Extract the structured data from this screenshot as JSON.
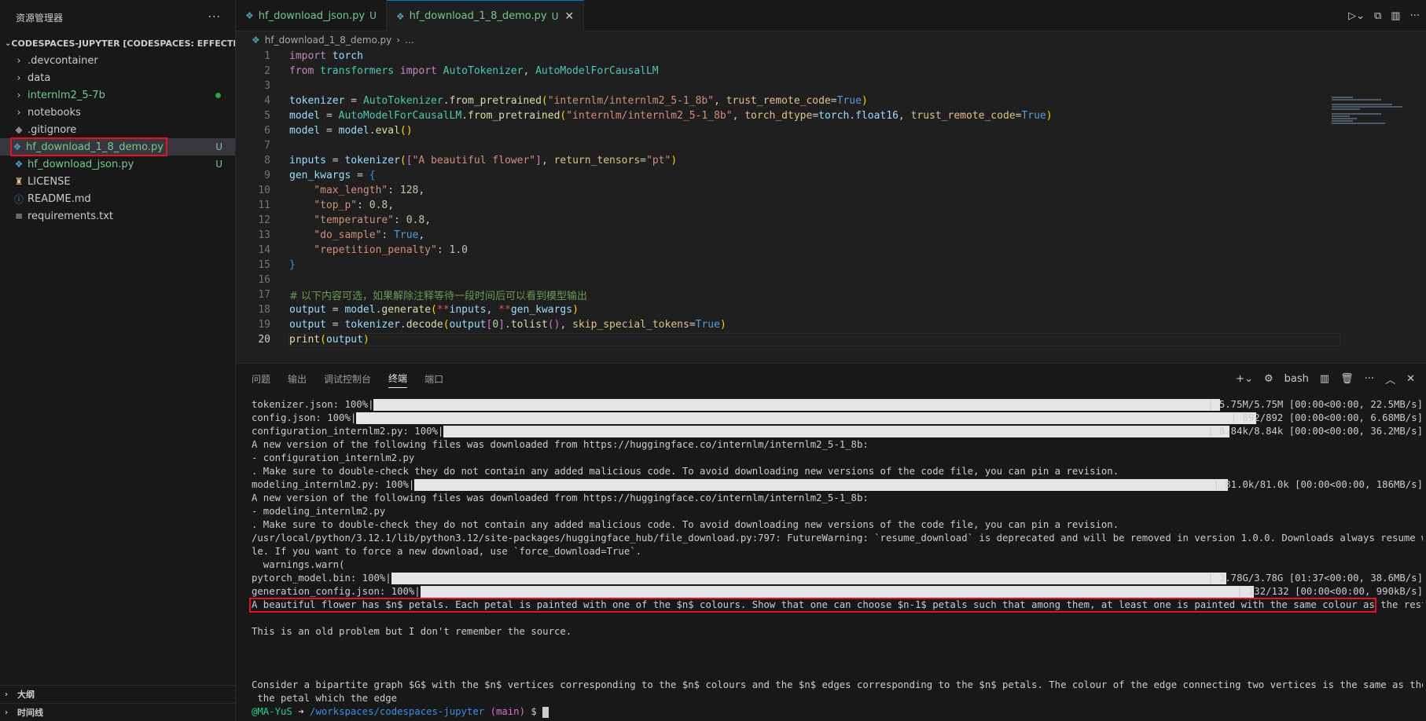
{
  "sidebar": {
    "title": "资源管理器",
    "more": "···",
    "workspace": "CODESPACES-JUPYTER [CODESPACES: EFFECTIVE P...",
    "items": [
      {
        "label": ".devcontainer",
        "type": "folder",
        "status": ""
      },
      {
        "label": "data",
        "type": "folder",
        "status": ""
      },
      {
        "label": "internlm2_5-7b",
        "type": "folder",
        "status": "dot"
      },
      {
        "label": "notebooks",
        "type": "folder",
        "status": ""
      },
      {
        "label": ".gitignore",
        "type": "git",
        "status": ""
      },
      {
        "label": "hf_download_1_8_demo.py",
        "type": "py",
        "status": "U"
      },
      {
        "label": "hf_download_json.py",
        "type": "py",
        "status": "U"
      },
      {
        "label": "LICENSE",
        "type": "license",
        "status": ""
      },
      {
        "label": "README.md",
        "type": "info",
        "status": ""
      },
      {
        "label": "requirements.txt",
        "type": "txt",
        "status": ""
      }
    ],
    "outline": "大纲",
    "timeline": "时间线"
  },
  "tabs": [
    {
      "label": "hf_download_json.py",
      "status": "U"
    },
    {
      "label": "hf_download_1_8_demo.py",
      "status": "U"
    }
  ],
  "breadcrumb": {
    "file": "hf_download_1_8_demo.py",
    "more": "..."
  },
  "code": {
    "line_numbers": [
      "1",
      "2",
      "3",
      "4",
      "5",
      "6",
      "7",
      "8",
      "9",
      "10",
      "11",
      "12",
      "13",
      "14",
      "15",
      "16",
      "17",
      "18",
      "19",
      "20"
    ],
    "current_line": "20",
    "lines": {
      "l1a": "import",
      "l1b": " torch",
      "l2a": "from",
      "l2b": " transformers ",
      "l2c": "import",
      "l2d": " AutoTokenizer",
      "l2e": ", ",
      "l2f": "AutoModelForCausalLM",
      "l4a": "tokenizer",
      "l4b": " = ",
      "l4c": "AutoTokenizer",
      "l4d": ".",
      "l4e": "from_pretrained",
      "l4f": "(",
      "l4g": "\"internlm/internlm2_5-1_8b\"",
      "l4h": ", ",
      "l4i": "trust_remote_code",
      "l4j": "=",
      "l4k": "True",
      "l4l": ")",
      "l5a": "model",
      "l5b": " = ",
      "l5c": "AutoModelForCausalLM",
      "l5d": ".",
      "l5e": "from_pretrained",
      "l5f": "(",
      "l5g": "\"internlm/internlm2_5-1_8b\"",
      "l5h": ", ",
      "l5i": "torch_dtype",
      "l5j": "=",
      "l5k": "torch",
      "l5l": ".float16, ",
      "l5m": "trust_remote_code",
      "l5n": "=",
      "l5o": "True",
      "l5p": ")",
      "l6a": "model",
      "l6b": " = ",
      "l6c": "model",
      "l6d": ".",
      "l6e": "eval",
      "l6f": "()",
      "l8a": "inputs",
      "l8b": " = ",
      "l8c": "tokenizer",
      "l8d": "(",
      "l8e": "[",
      "l8f": "\"A beautiful flower\"",
      "l8g": "]",
      "l8h": ", ",
      "l8i": "return_tensors",
      "l8j": "=",
      "l8k": "\"pt\"",
      "l8l": ")",
      "l9a": "gen_kwargs",
      "l9b": " = ",
      "l9c": "{",
      "l10a": "    \"max_length\"",
      "l10b": ": ",
      "l10c": "128",
      "l10d": ",",
      "l11a": "    \"top_p\"",
      "l11b": ": ",
      "l11c": "0.8",
      "l11d": ",",
      "l12a": "    \"temperature\"",
      "l12b": ": ",
      "l12c": "0.8",
      "l12d": ",",
      "l13a": "    \"do_sample\"",
      "l13b": ": ",
      "l13c": "True",
      "l13d": ",",
      "l14a": "    \"repetition_penalty\"",
      "l14b": ": ",
      "l14c": "1.0",
      "l15a": "}",
      "l17a": "# 以下内容可选，如果解除注释等待一段时间后可以看到模型输出",
      "l18a": "output",
      "l18b": " = ",
      "l18c": "model",
      "l18d": ".",
      "l18e": "generate",
      "l18f": "(",
      "l18g": "**",
      "l18h": "inputs",
      "l18i": ", ",
      "l18j": "**",
      "l18k": "gen_kwargs",
      "l18l": ")",
      "l19a": "output",
      "l19b": " = ",
      "l19c": "tokenizer",
      "l19d": ".",
      "l19e": "decode",
      "l19f": "(",
      "l19g": "output",
      "l19h": "[",
      "l19i": "0",
      "l19j": "]",
      "l19k": ".",
      "l19l": "tolist",
      "l19m": "()",
      "l19n": ", ",
      "l19o": "skip_special_tokens",
      "l19p": "=",
      "l19q": "True",
      "l19r": ")",
      "l20a": "print",
      "l20b": "(",
      "l20c": "output",
      "l20d": ")"
    }
  },
  "panel": {
    "tabs": [
      "问题",
      "输出",
      "调试控制台",
      "终端",
      "端口"
    ],
    "active_tab": "终端",
    "shell": "bash"
  },
  "terminal": {
    "progress": [
      {
        "label": "tokenizer.json: 100%|",
        "stats": "| 5.75M/5.75M [00:00<00:00, 22.5MB/s]",
        "fraction": 1.0
      },
      {
        "label": "config.json: 100%|",
        "stats": "| 892/892 [00:00<00:00, 6.68MB/s]",
        "fraction": 1.0
      },
      {
        "label": "configuration_internlm2.py: 100%|",
        "stats": "| 8.84k/8.84k [00:00<00:00, 36.2MB/s]",
        "fraction": 1.0
      },
      {
        "label": "modeling_internlm2.py: 100%|",
        "stats": "| 81.0k/81.0k [00:00<00:00, 186MB/s]",
        "fraction": 1.0
      },
      {
        "label": "pytorch_model.bin: 100%|",
        "stats": "| 3.78G/3.78G [01:37<00:00, 38.6MB/s]",
        "fraction": 1.0
      },
      {
        "label": "generation_config.json: 100%|",
        "stats": "| 132/132 [00:00<00:00, 990kB/s]",
        "fraction": 1.0
      }
    ],
    "msg1": "A new version of the following files was downloaded from https://huggingface.co/internlm/internlm2_5-1_8b:",
    "msg1_file": "- configuration_internlm2.py",
    "msg1_note": ". Make sure to double-check they do not contain any added malicious code. To avoid downloading new versions of the code file, you can pin a revision.",
    "msg2": "A new version of the following files was downloaded from https://huggingface.co/internlm/internlm2_5-1_8b:",
    "msg2_file": "- modeling_internlm2.py",
    "msg2_note": ". Make sure to double-check they do not contain any added malicious code. To avoid downloading new versions of the code file, you can pin a revision.",
    "warn1": "/usr/local/python/3.12.1/lib/python3.12/site-packages/huggingface_hub/file_download.py:797: FutureWarning: `resume_download` is deprecated and will be removed in version 1.0.0. Downloads always resume when possib",
    "warn2": "le. If you want to force a new download, use `force_download=True`.",
    "warn3": "  warnings.warn(",
    "output1": "A beautiful flower has $n$ petals. Each petal is painted with one of the $n$ colours. Show that one can choose $n-1$ petals such that among them, at least one is painted with the same colour as the rest.",
    "output2": "This is an old problem but I don't remember the source.",
    "output3": "Consider a bipartite graph $G$ with the $n$ vertices corresponding to the $n$ colours and the $n$ edges corresponding to the $n$ petals. The colour of the edge connecting two vertices is the same as the colour of",
    "output4": " the petal which the edge",
    "prompt_user": "@MA-YuS",
    "prompt_arrow": " ➜ ",
    "prompt_path": "/workspaces/codespaces-jupyter",
    "prompt_branch": "(main)",
    "prompt_symbol": " $ "
  }
}
